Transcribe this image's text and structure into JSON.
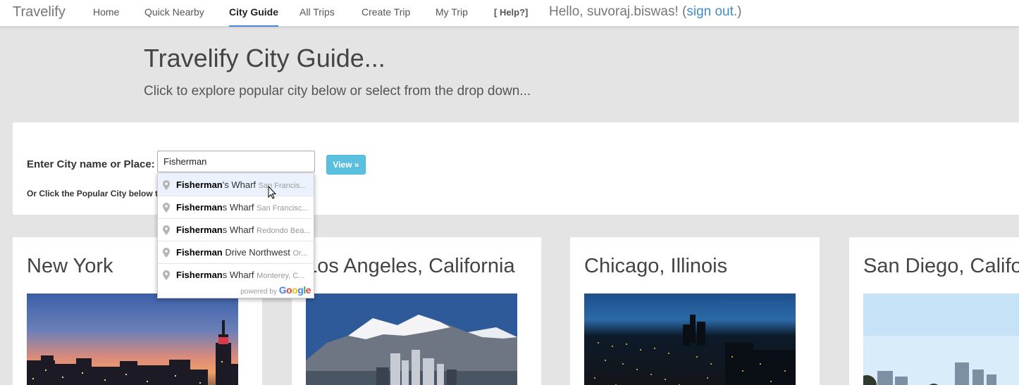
{
  "navbar": {
    "brand": "Travelify",
    "items": [
      {
        "label": "Home"
      },
      {
        "label": "Quick Nearby"
      },
      {
        "label": "City Guide"
      },
      {
        "label": "All Trips"
      },
      {
        "label": "Create Trip"
      },
      {
        "label": "My Trip"
      },
      {
        "label": "[ Help?]"
      }
    ],
    "greeting_prefix": "Hello, suvoraj.biswas! (",
    "signout": "sign out.",
    "greeting_suffix": ")"
  },
  "header": {
    "title": "Travelify City Guide...",
    "subtitle": "Click to explore popular city below or select from the drop down..."
  },
  "search": {
    "label": "Enter City name or Place:",
    "value": "Fisherman",
    "button": "View »",
    "or_click": "Or Click the Popular City below t"
  },
  "autocomplete": {
    "items": [
      {
        "match": "Fisherman",
        "rest": "'s Wharf",
        "secondary": "San Francis..."
      },
      {
        "match": "Fisherman",
        "rest": "s Wharf",
        "secondary": "San Francisc..."
      },
      {
        "match": "Fisherman",
        "rest": "s Wharf",
        "secondary": "Redondo Bea..."
      },
      {
        "match": "Fisherman",
        "rest": " Drive Northwest",
        "secondary": "Or..."
      },
      {
        "match": "Fisherman",
        "rest": "s Wharf",
        "secondary": "Monterey, C..."
      }
    ],
    "powered_by": "powered by",
    "google": "Google"
  },
  "cities": [
    {
      "name": "New York"
    },
    {
      "name": "Los Angeles, California"
    },
    {
      "name": "Chicago, Illinois"
    },
    {
      "name": "San Diego, California"
    }
  ]
}
